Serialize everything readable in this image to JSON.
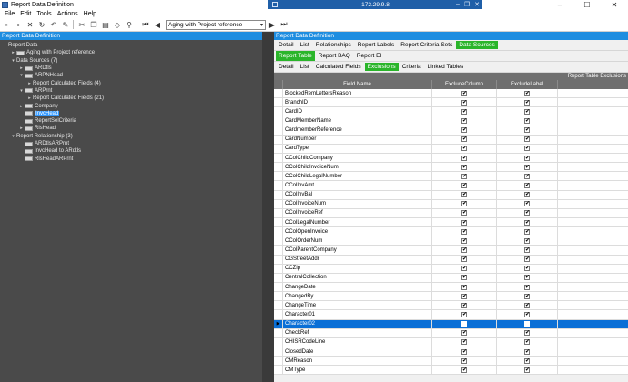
{
  "window": {
    "title": "Report Data Definition",
    "remote_title": "172.29.9.8"
  },
  "menu": [
    "File",
    "Edit",
    "Tools",
    "Actions",
    "Help"
  ],
  "toolbar": {
    "combo_value": "Aging with Project reference"
  },
  "left_panel": {
    "header": "Report Data Definition",
    "tree": [
      {
        "label": "Report Data",
        "indent": 0,
        "toggle": "",
        "icon": false,
        "selected": false
      },
      {
        "label": "Aging with Project reference",
        "indent": 1,
        "toggle": "▸",
        "icon": true,
        "selected": false
      },
      {
        "label": "Data Sources (7)",
        "indent": 1,
        "toggle": "▾",
        "icon": false,
        "selected": false
      },
      {
        "label": "ARDtls",
        "indent": 2,
        "toggle": "▸",
        "icon": true,
        "selected": false
      },
      {
        "label": "ARPNHead",
        "indent": 2,
        "toggle": "▾",
        "icon": true,
        "selected": false
      },
      {
        "label": "Report Calculated Fields (4)",
        "indent": 3,
        "toggle": "▸",
        "icon": false,
        "selected": false
      },
      {
        "label": "ARPrnt",
        "indent": 2,
        "toggle": "▾",
        "icon": true,
        "selected": false
      },
      {
        "label": "Report Calculated Fields (21)",
        "indent": 3,
        "toggle": "▸",
        "icon": false,
        "selected": false
      },
      {
        "label": "Company",
        "indent": 2,
        "toggle": "▸",
        "icon": true,
        "selected": false
      },
      {
        "label": "InvcHead",
        "indent": 2,
        "toggle": "",
        "icon": true,
        "selected": true
      },
      {
        "label": "ReportSelCriteria",
        "indent": 2,
        "toggle": "",
        "icon": true,
        "selected": false
      },
      {
        "label": "RlsHead",
        "indent": 2,
        "toggle": "▸",
        "icon": true,
        "selected": false
      },
      {
        "label": "Report Relationship (3)",
        "indent": 1,
        "toggle": "▾",
        "icon": false,
        "selected": false
      },
      {
        "label": "ARDtlsARPrnt",
        "indent": 2,
        "toggle": "",
        "icon": true,
        "selected": false
      },
      {
        "label": "InvcHead to ARdtls",
        "indent": 2,
        "toggle": "",
        "icon": true,
        "selected": false
      },
      {
        "label": "RlsHeadARPrnt",
        "indent": 2,
        "toggle": "",
        "icon": true,
        "selected": false
      }
    ]
  },
  "right_panel": {
    "header": "Report Data Definition",
    "tabs1": [
      {
        "label": "Detail",
        "active": false
      },
      {
        "label": "List",
        "active": false
      },
      {
        "label": "Relationships",
        "active": false
      },
      {
        "label": "Report Labels",
        "active": false
      },
      {
        "label": "Report Criteria Sets",
        "active": false
      },
      {
        "label": "Data Sources",
        "active": true
      }
    ],
    "tabs2": [
      {
        "label": "Report Table",
        "active": true
      },
      {
        "label": "Report BAQ",
        "active": false
      },
      {
        "label": "Report EI",
        "active": false
      }
    ],
    "tabs3": [
      {
        "label": "Detail",
        "active": false
      },
      {
        "label": "List",
        "active": false
      },
      {
        "label": "Calculated Fields",
        "active": false
      },
      {
        "label": "Exclusions",
        "active": true
      },
      {
        "label": "Criteria",
        "active": false
      },
      {
        "label": "Linked Tables",
        "active": false
      }
    ],
    "grid_caption": "Report Table Exclusions",
    "columns": [
      "Field Name",
      "ExcludeColumn",
      "ExcludeLabel"
    ],
    "rows": [
      {
        "name": "BlockedRemLettersReason",
        "col": true,
        "lab": true
      },
      {
        "name": "BranchID",
        "col": true,
        "lab": true
      },
      {
        "name": "CardID",
        "col": true,
        "lab": true
      },
      {
        "name": "CardMemberName",
        "col": true,
        "lab": true
      },
      {
        "name": "CardmemberReference",
        "col": true,
        "lab": true
      },
      {
        "name": "CardNumber",
        "col": true,
        "lab": true
      },
      {
        "name": "CardType",
        "col": true,
        "lab": true
      },
      {
        "name": "CColChildCompany",
        "col": true,
        "lab": true
      },
      {
        "name": "CColChildInvoiceNum",
        "col": true,
        "lab": true
      },
      {
        "name": "CColChildLegalNumber",
        "col": true,
        "lab": true
      },
      {
        "name": "CColInvAmt",
        "col": true,
        "lab": true
      },
      {
        "name": "CColInvBal",
        "col": true,
        "lab": true
      },
      {
        "name": "CColInvoiceNum",
        "col": true,
        "lab": true
      },
      {
        "name": "CColInvoiceRef",
        "col": true,
        "lab": true
      },
      {
        "name": "CColLegalNumber",
        "col": true,
        "lab": true
      },
      {
        "name": "CColOpenInvoice",
        "col": true,
        "lab": true
      },
      {
        "name": "CColOrderNum",
        "col": true,
        "lab": true
      },
      {
        "name": "CColParentCompany",
        "col": true,
        "lab": true
      },
      {
        "name": "CGStreetAddr",
        "col": true,
        "lab": true
      },
      {
        "name": "CCZip",
        "col": true,
        "lab": true
      },
      {
        "name": "CentralCollection",
        "col": true,
        "lab": true
      },
      {
        "name": "ChangeDate",
        "col": true,
        "lab": true
      },
      {
        "name": "ChangedBy",
        "col": true,
        "lab": true
      },
      {
        "name": "ChangeTime",
        "col": true,
        "lab": true
      },
      {
        "name": "Character01",
        "col": true,
        "lab": true
      },
      {
        "name": "Character02",
        "col": false,
        "lab": false,
        "selected": true
      },
      {
        "name": "CheckRef",
        "col": true,
        "lab": true
      },
      {
        "name": "CHISRCodeLine",
        "col": true,
        "lab": true
      },
      {
        "name": "ClosedDate",
        "col": true,
        "lab": true
      },
      {
        "name": "CMReason",
        "col": true,
        "lab": true
      },
      {
        "name": "CMType",
        "col": true,
        "lab": true
      }
    ]
  }
}
